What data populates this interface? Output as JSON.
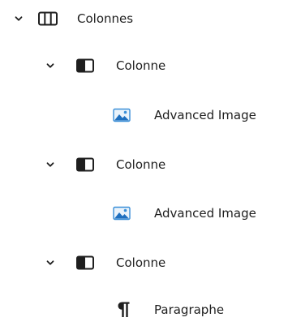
{
  "tree": {
    "root": {
      "label": "Colonnes",
      "icon": "columns-icon",
      "expanded": true
    },
    "columns": [
      {
        "label": "Colonne",
        "icon": "column-icon",
        "expanded": true,
        "child": {
          "label": "Advanced Image",
          "icon": "image-icon"
        }
      },
      {
        "label": "Colonne",
        "icon": "column-icon",
        "expanded": true,
        "child": {
          "label": "Advanced Image",
          "icon": "image-icon"
        }
      },
      {
        "label": "Colonne",
        "icon": "column-icon",
        "expanded": true,
        "child": {
          "label": "Paragraphe",
          "icon": "paragraph-icon"
        }
      }
    ]
  },
  "colors": {
    "text": "#1e1e1e",
    "image_blue": "#3a8fd8"
  }
}
